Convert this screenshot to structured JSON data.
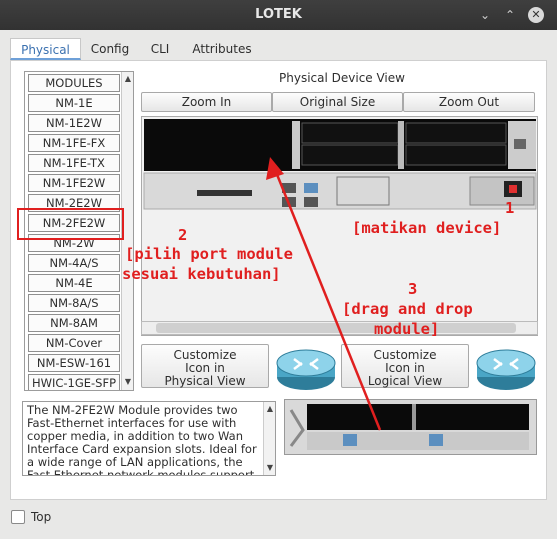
{
  "window": {
    "title": "LOTEK",
    "controls": {
      "minimize": "⌄",
      "maximize": "⌃",
      "close": "✕"
    }
  },
  "tabs": [
    {
      "label": "Physical",
      "active": true
    },
    {
      "label": "Config",
      "active": false
    },
    {
      "label": "CLI",
      "active": false
    },
    {
      "label": "Attributes",
      "active": false
    }
  ],
  "modules": [
    "MODULES",
    "NM-1E",
    "NM-1E2W",
    "NM-1FE-FX",
    "NM-1FE-TX",
    "NM-1FE2W",
    "NM-2E2W",
    "NM-2FE2W",
    "NM-2W",
    "NM-4A/S",
    "NM-4E",
    "NM-8A/S",
    "NM-8AM",
    "NM-Cover",
    "NM-ESW-161",
    "HWIC-1GE-SFP"
  ],
  "selected_module": "NM-2FE2W",
  "view": {
    "title": "Physical Device View",
    "zoom_in": "Zoom In",
    "original_size": "Original Size",
    "zoom_out": "Zoom Out"
  },
  "customize_physical": {
    "line1": "Customize",
    "line2": "Icon in",
    "line3": "Physical View"
  },
  "customize_logical": {
    "line1": "Customize",
    "line2": "Icon in",
    "line3": "Logical View"
  },
  "description": "The NM-2FE2W Module provides two Fast-Ethernet interfaces for use with copper media, in addition to two Wan Interface Card expansion slots. Ideal for a wide range of LAN applications, the Fast Ethernet network modules support many",
  "annotations": {
    "a1_num": "1",
    "a1_text": "[matikan device]",
    "a2_num": "2",
    "a2_line1": "[pilih port module",
    "a2_line2": "sesuai kebutuhan]",
    "a3_num": "3",
    "a3_line1": "[drag and drop",
    "a3_line2": "module]"
  },
  "colors": {
    "annotation": "#e01f1f",
    "tab_active": "#3b71b0"
  },
  "footer": {
    "top_label": "Top",
    "top_checked": false
  }
}
